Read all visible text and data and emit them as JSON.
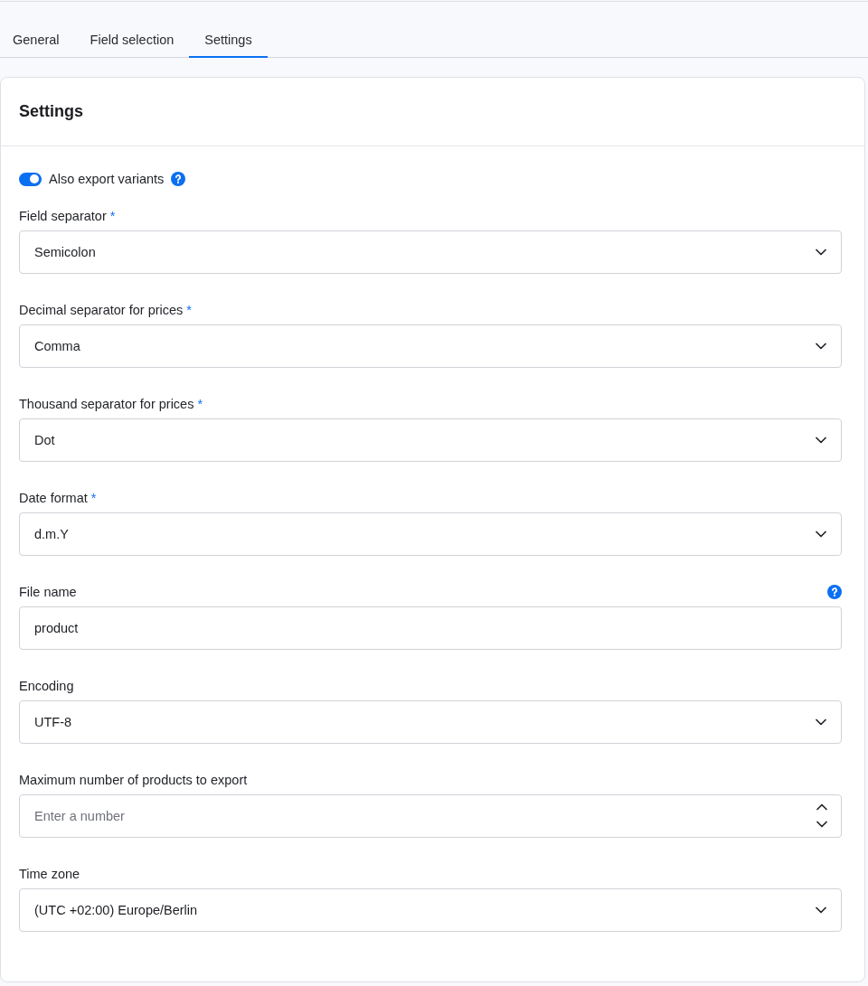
{
  "tabs": [
    {
      "label": "General",
      "selected": false
    },
    {
      "label": "Field selection",
      "selected": false
    },
    {
      "label": "Settings",
      "selected": true
    }
  ],
  "panel": {
    "title": "Settings",
    "variants_toggle": {
      "label": "Also export variants",
      "on": true,
      "help": true
    },
    "fields": [
      {
        "kind": "select",
        "label": "Field separator",
        "required_mark": "*",
        "help": false,
        "value": "Semicolon"
      },
      {
        "kind": "select",
        "label": "Decimal separator for prices",
        "required_mark": "*",
        "help": false,
        "value": "Comma"
      },
      {
        "kind": "select",
        "label": "Thousand separator for prices",
        "required_mark": "*",
        "help": false,
        "value": "Dot"
      },
      {
        "kind": "select",
        "label": "Date format",
        "required_mark": "*",
        "help": false,
        "value": "d.m.Y"
      },
      {
        "kind": "text",
        "label": "File name",
        "help": true,
        "value": "product"
      },
      {
        "kind": "select",
        "label": "Encoding",
        "help": false,
        "value": "UTF-8"
      },
      {
        "kind": "number",
        "label": "Maximum number of products to export",
        "help": false,
        "placeholder": "Enter a number"
      },
      {
        "kind": "select",
        "label": "Time zone",
        "help": false,
        "value": "(UTC +02:00) Europe/Berlin"
      }
    ]
  }
}
